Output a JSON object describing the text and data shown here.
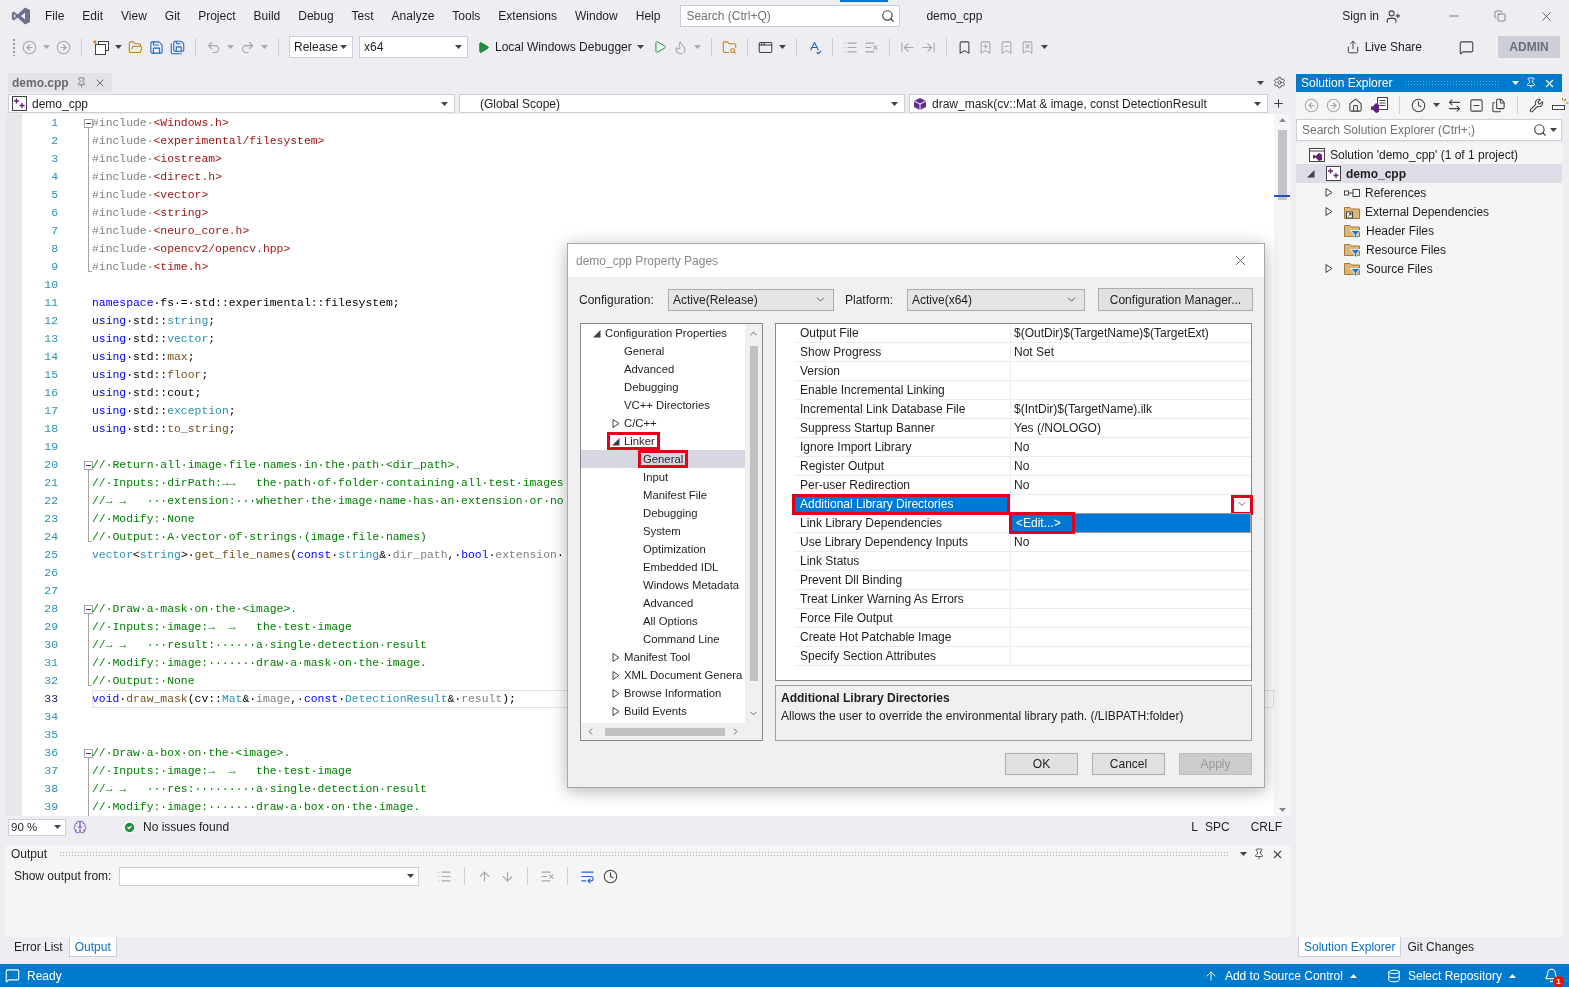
{
  "menu_bar": {
    "items": [
      "File",
      "Edit",
      "View",
      "Git",
      "Project",
      "Build",
      "Debug",
      "Test",
      "Analyze",
      "Tools",
      "Extensions",
      "Window",
      "Help"
    ],
    "search": {
      "placeholder": "Search (Ctrl+Q)"
    },
    "solution_name": "demo_cpp",
    "sign_in": "Sign in"
  },
  "toolbar": {
    "configuration": "Release",
    "platform": "x64",
    "debugger": "Local Windows Debugger",
    "live_share": "Live Share",
    "account_badge": "ADMIN"
  },
  "editor": {
    "tab": {
      "label": "demo.cpp"
    },
    "navigation": {
      "project": "demo_cpp",
      "scope": "(Global Scope)",
      "member": "draw_mask(cv::Mat & image, const DetectionResult"
    },
    "lines": [
      {
        "number": "1",
        "current": false,
        "kind": "opener",
        "tokens": [
          {
            "kind": "preproc",
            "text": "#include·"
          },
          {
            "kind": "string",
            "text": "<Windows.h>"
          }
        ]
      },
      {
        "number": "2",
        "current": false,
        "kind": "body",
        "tokens": [
          {
            "kind": "preproc",
            "text": "#include·"
          },
          {
            "kind": "string",
            "text": "<experimental/filesystem>"
          }
        ]
      },
      {
        "number": "3",
        "current": false,
        "kind": "body",
        "tokens": [
          {
            "kind": "preproc",
            "text": "#include·"
          },
          {
            "kind": "string",
            "text": "<iostream>"
          }
        ]
      },
      {
        "number": "4",
        "current": false,
        "kind": "body",
        "tokens": [
          {
            "kind": "preproc",
            "text": "#include·"
          },
          {
            "kind": "string",
            "text": "<direct.h>"
          }
        ]
      },
      {
        "number": "5",
        "current": false,
        "kind": "body",
        "tokens": [
          {
            "kind": "preproc",
            "text": "#include·"
          },
          {
            "kind": "string",
            "text": "<vector>"
          }
        ]
      },
      {
        "number": "6",
        "current": false,
        "kind": "body",
        "tokens": [
          {
            "kind": "preproc",
            "text": "#include·"
          },
          {
            "kind": "string",
            "text": "<string>"
          }
        ]
      },
      {
        "number": "7",
        "current": false,
        "kind": "body",
        "tokens": [
          {
            "kind": "preproc",
            "text": "#include·"
          },
          {
            "kind": "string",
            "text": "<neuro_core.h>"
          }
        ]
      },
      {
        "number": "8",
        "current": false,
        "kind": "body",
        "tokens": [
          {
            "kind": "preproc",
            "text": "#include·"
          },
          {
            "kind": "string",
            "text": "<opencv2/opencv.hpp>"
          }
        ]
      },
      {
        "number": "9",
        "current": false,
        "kind": "closer",
        "tokens": [
          {
            "kind": "preproc",
            "text": "#include·"
          },
          {
            "kind": "string",
            "text": "<time.h>"
          }
        ]
      },
      {
        "number": "10",
        "current": false,
        "kind": "plain"
      },
      {
        "number": "11",
        "current": false,
        "kind": "plain",
        "tokens": [
          {
            "kind": "keyword",
            "text": "namespace"
          },
          {
            "kind": "plain",
            "text": "·fs·=·std::experimental::filesystem;"
          }
        ]
      },
      {
        "number": "12",
        "current": false,
        "kind": "plain",
        "tokens": [
          {
            "kind": "keyword",
            "text": "using"
          },
          {
            "kind": "plain",
            "text": "·std::"
          },
          {
            "kind": "type",
            "text": "string"
          },
          {
            "kind": "plain",
            "text": ";"
          }
        ]
      },
      {
        "number": "13",
        "current": false,
        "kind": "plain",
        "tokens": [
          {
            "kind": "keyword",
            "text": "using"
          },
          {
            "kind": "plain",
            "text": "·std::"
          },
          {
            "kind": "type",
            "text": "vector"
          },
          {
            "kind": "plain",
            "text": ";"
          }
        ]
      },
      {
        "number": "14",
        "current": false,
        "kind": "plain",
        "tokens": [
          {
            "kind": "keyword",
            "text": "using"
          },
          {
            "kind": "plain",
            "text": "·std::"
          },
          {
            "kind": "func",
            "text": "max"
          },
          {
            "kind": "plain",
            "text": ";"
          }
        ]
      },
      {
        "number": "15",
        "current": false,
        "kind": "plain",
        "tokens": [
          {
            "kind": "keyword",
            "text": "using"
          },
          {
            "kind": "plain",
            "text": "·std::"
          },
          {
            "kind": "func",
            "text": "floor"
          },
          {
            "kind": "plain",
            "text": ";"
          }
        ]
      },
      {
        "number": "16",
        "current": false,
        "kind": "plain",
        "tokens": [
          {
            "kind": "keyword",
            "text": "using"
          },
          {
            "kind": "plain",
            "text": "·std::cout;"
          }
        ]
      },
      {
        "number": "17",
        "current": false,
        "kind": "plain",
        "tokens": [
          {
            "kind": "keyword",
            "text": "using"
          },
          {
            "kind": "plain",
            "text": "·std::"
          },
          {
            "kind": "type",
            "text": "exception"
          },
          {
            "kind": "plain",
            "text": ";"
          }
        ]
      },
      {
        "number": "18",
        "current": false,
        "kind": "plain",
        "tokens": [
          {
            "kind": "keyword",
            "text": "using"
          },
          {
            "kind": "plain",
            "text": "·std::"
          },
          {
            "kind": "func",
            "text": "to_string"
          },
          {
            "kind": "plain",
            "text": ";"
          }
        ]
      },
      {
        "number": "19",
        "current": false,
        "kind": "plain"
      },
      {
        "number": "20",
        "current": false,
        "kind": "opener",
        "tokens": [
          {
            "kind": "comment",
            "text": "//·Return·all·image·file·names·in·the·path·<dir_path>."
          }
        ]
      },
      {
        "number": "21",
        "current": false,
        "kind": "body",
        "tokens": [
          {
            "kind": "comment",
            "text": "//·Inputs:·dirPath:→→   the·path·of·folder·containing·all·test·images"
          }
        ]
      },
      {
        "number": "22",
        "current": false,
        "kind": "body",
        "tokens": [
          {
            "kind": "comment",
            "text": "//→ →   ···extension:···whether·the·image·name·has·an·extension·or·no"
          }
        ]
      },
      {
        "number": "23",
        "current": false,
        "kind": "body",
        "tokens": [
          {
            "kind": "comment",
            "text": "//·Modify:·None"
          }
        ]
      },
      {
        "number": "24",
        "current": false,
        "kind": "closer",
        "tokens": [
          {
            "kind": "comment",
            "text": "//·Output:·A·vector·of·strings·(image·file·names)"
          }
        ]
      },
      {
        "number": "25",
        "current": false,
        "kind": "plain",
        "tokens": [
          {
            "kind": "type",
            "text": "vector"
          },
          {
            "kind": "plain",
            "text": "<"
          },
          {
            "kind": "type",
            "text": "string"
          },
          {
            "kind": "plain",
            "text": ">·"
          },
          {
            "kind": "func",
            "text": "get_file_names"
          },
          {
            "kind": "plain",
            "text": "("
          },
          {
            "kind": "keyword",
            "text": "const"
          },
          {
            "kind": "plain",
            "text": "·"
          },
          {
            "kind": "type",
            "text": "string"
          },
          {
            "kind": "plain",
            "text": "&·"
          },
          {
            "kind": "param",
            "text": "dir_path"
          },
          {
            "kind": "plain",
            "text": ",·"
          },
          {
            "kind": "keyword",
            "text": "bool"
          },
          {
            "kind": "plain",
            "text": "·"
          },
          {
            "kind": "param",
            "text": "extension"
          },
          {
            "kind": "plain",
            "text": "·"
          }
        ]
      },
      {
        "number": "26",
        "current": false,
        "kind": "plain"
      },
      {
        "number": "27",
        "current": false,
        "kind": "plain"
      },
      {
        "number": "28",
        "current": false,
        "kind": "opener",
        "tokens": [
          {
            "kind": "comment",
            "text": "//·Draw·a·mask·on·the·<image>."
          }
        ]
      },
      {
        "number": "29",
        "current": false,
        "kind": "body",
        "tokens": [
          {
            "kind": "comment",
            "text": "//·Inputs:·image:→  →   the·test·image"
          }
        ]
      },
      {
        "number": "30",
        "current": false,
        "kind": "body",
        "tokens": [
          {
            "kind": "comment",
            "text": "//→ →   ···result:······a·single·detection·result"
          }
        ]
      },
      {
        "number": "31",
        "current": false,
        "kind": "body",
        "tokens": [
          {
            "kind": "comment",
            "text": "//·Modify:·image:·······draw·a·mask·on·the·image."
          }
        ]
      },
      {
        "number": "32",
        "current": false,
        "kind": "closer",
        "tokens": [
          {
            "kind": "comment",
            "text": "//·Output:·None"
          }
        ]
      },
      {
        "number": "33",
        "current": true,
        "kind": "plain",
        "tokens": [
          {
            "kind": "keyword",
            "text": "void"
          },
          {
            "kind": "plain",
            "text": "·"
          },
          {
            "kind": "func",
            "text": "draw_mask"
          },
          {
            "kind": "plain",
            "text": "(cv::"
          },
          {
            "kind": "type",
            "text": "Mat"
          },
          {
            "kind": "plain",
            "text": "&·"
          },
          {
            "kind": "param",
            "text": "image"
          },
          {
            "kind": "plain",
            "text": ",·"
          },
          {
            "kind": "keyword",
            "text": "const"
          },
          {
            "kind": "plain",
            "text": "·"
          },
          {
            "kind": "type",
            "text": "DetectionResult"
          },
          {
            "kind": "plain",
            "text": "&·"
          },
          {
            "kind": "param",
            "text": "result"
          },
          {
            "kind": "plain",
            "text": ");"
          }
        ]
      },
      {
        "number": "34",
        "current": false,
        "kind": "plain"
      },
      {
        "number": "35",
        "current": false,
        "kind": "plain"
      },
      {
        "number": "36",
        "current": false,
        "kind": "opener",
        "tokens": [
          {
            "kind": "comment",
            "text": "//·Draw·a·box·on·the·<image>."
          }
        ]
      },
      {
        "number": "37",
        "current": false,
        "kind": "body",
        "tokens": [
          {
            "kind": "comment",
            "text": "//·Inputs:·image:→  →   the·test·image"
          }
        ]
      },
      {
        "number": "38",
        "current": false,
        "kind": "body",
        "tokens": [
          {
            "kind": "comment",
            "text": "//→ →   ···res:·········a·single·detection·result"
          }
        ]
      },
      {
        "number": "39",
        "current": false,
        "kind": "body",
        "tokens": [
          {
            "kind": "comment",
            "text": "//·Modify:·image:·······draw·a·box·on·the·image."
          }
        ]
      }
    ],
    "status": {
      "zoom": "90 %",
      "issues": "No issues found",
      "column_3": "L",
      "whitespace": "SPC",
      "line_endings": "CRLF"
    }
  },
  "property_dialog": {
    "title": "demo_cpp Property Pages",
    "configuration": {
      "label": "Configuration:",
      "value": "Active(Release)"
    },
    "platform": {
      "label": "Platform:",
      "value": "Active(x64)"
    },
    "manager_button": "Configuration Manager...",
    "tree": [
      {
        "label": "Configuration Properties",
        "expanded": true,
        "selected": false,
        "marked": false,
        "children": [
          {
            "label": "General",
            "selected": false,
            "marked": false
          },
          {
            "label": "Advanced",
            "selected": false,
            "marked": false
          },
          {
            "label": "Debugging",
            "selected": false,
            "marked": false
          },
          {
            "label": "VC++ Directories",
            "selected": false,
            "marked": false
          },
          {
            "label": "C/C++",
            "expanded": false,
            "selected": false,
            "marked": false
          },
          {
            "label": "Linker",
            "expanded": true,
            "selected": false,
            "marked": true,
            "children": [
              {
                "label": "General",
                "selected": true,
                "marked": true
              },
              {
                "label": "Input",
                "selected": false,
                "marked": false
              },
              {
                "label": "Manifest File",
                "selected": false,
                "marked": false
              },
              {
                "label": "Debugging",
                "selected": false,
                "marked": false
              },
              {
                "label": "System",
                "selected": false,
                "marked": false
              },
              {
                "label": "Optimization",
                "selected": false,
                "marked": false
              },
              {
                "label": "Embedded IDL",
                "selected": false,
                "marked": false
              },
              {
                "label": "Windows Metadata",
                "selected": false,
                "marked": false
              },
              {
                "label": "Advanced",
                "selected": false,
                "marked": false
              },
              {
                "label": "All Options",
                "selected": false,
                "marked": false
              },
              {
                "label": "Command Line",
                "selected": false,
                "marked": false
              }
            ]
          },
          {
            "label": "Manifest Tool",
            "expanded": false,
            "selected": false,
            "marked": false
          },
          {
            "label": "XML Document Genera",
            "expanded": false,
            "selected": false,
            "marked": false
          },
          {
            "label": "Browse Information",
            "expanded": false,
            "selected": false,
            "marked": false
          },
          {
            "label": "Build Events",
            "expanded": false,
            "selected": false,
            "marked": false
          }
        ]
      }
    ],
    "properties": [
      {
        "name": "Output File",
        "value": "$(OutDir)$(TargetName)$(TargetExt)",
        "selected": false,
        "marked": false
      },
      {
        "name": "Show Progress",
        "value": "Not Set",
        "selected": false,
        "marked": false
      },
      {
        "name": "Version",
        "selected": false,
        "marked": false
      },
      {
        "name": "Enable Incremental Linking",
        "selected": false,
        "marked": false
      },
      {
        "name": "Incremental Link Database File",
        "value": "$(IntDir)$(TargetName).ilk",
        "selected": false,
        "marked": false
      },
      {
        "name": "Suppress Startup Banner",
        "value": "Yes (/NOLOGO)",
        "selected": false,
        "marked": false
      },
      {
        "name": "Ignore Import Library",
        "value": "No",
        "selected": false,
        "marked": false
      },
      {
        "name": "Register Output",
        "value": "No",
        "selected": false,
        "marked": false
      },
      {
        "name": "Per-user Redirection",
        "value": "No",
        "selected": false,
        "marked": false
      },
      {
        "name": "Additional Library Directories",
        "selected": true,
        "marked": true
      },
      {
        "name": "Link Library Dependencies",
        "selected": false,
        "marked": false
      },
      {
        "name": "Use Library Dependency Inputs",
        "value": "No",
        "selected": false,
        "marked": false
      },
      {
        "name": "Link Status",
        "selected": false,
        "marked": false
      },
      {
        "name": "Prevent Dll Binding",
        "selected": false,
        "marked": false
      },
      {
        "name": "Treat Linker Warning As Errors",
        "selected": false,
        "marked": false
      },
      {
        "name": "Force File Output",
        "selected": false,
        "marked": false
      },
      {
        "name": "Create Hot Patchable Image",
        "selected": false,
        "marked": false
      },
      {
        "name": "Specify Section Attributes",
        "selected": false,
        "marked": false
      }
    ],
    "value_dropdown": {
      "marked": true,
      "options": [
        {
          "label": "<Edit...>",
          "selected": true,
          "marked": true
        }
      ]
    },
    "description": {
      "title": "Additional Library Directories",
      "text": "Allows the user to override the environmental library path. (/LIBPATH:folder)"
    },
    "buttons": [
      {
        "label": "OK",
        "disabled": false
      },
      {
        "label": "Cancel",
        "disabled": false
      },
      {
        "label": "Apply",
        "disabled": true
      }
    ]
  },
  "output": {
    "title": "Output",
    "source_label": "Show output from:",
    "tabs": [
      {
        "label": "Error List",
        "selected": false
      },
      {
        "label": "Output",
        "selected": true
      }
    ]
  },
  "solution_explorer": {
    "title": "Solution Explorer",
    "search": {
      "placeholder": "Search Solution Explorer (Ctrl+;)"
    },
    "tree": [
      {
        "label": "Solution 'demo_cpp' (1 of 1 project)",
        "kind": "solution",
        "selected": false,
        "children": [
          {
            "label": "demo_cpp",
            "kind": "project",
            "expanded": true,
            "selected": true,
            "children": [
              {
                "label": "References",
                "kind": "references",
                "expanded": false,
                "selected": false
              },
              {
                "label": "External Dependencies",
                "kind": "external",
                "expanded": false,
                "selected": false
              },
              {
                "label": "Header Files",
                "kind": "filter",
                "selected": false
              },
              {
                "label": "Resource Files",
                "kind": "filter",
                "selected": false
              },
              {
                "label": "Source Files",
                "kind": "filter",
                "expanded": false,
                "selected": false
              }
            ]
          }
        ]
      }
    ],
    "tabs": [
      {
        "label": "Solution Explorer",
        "selected": true
      },
      {
        "label": "Git Changes",
        "selected": false
      }
    ]
  },
  "status_bar": {
    "message": "Ready",
    "source_control": "Add to Source Control",
    "repository": "Select Repository",
    "notification_count": "1"
  }
}
